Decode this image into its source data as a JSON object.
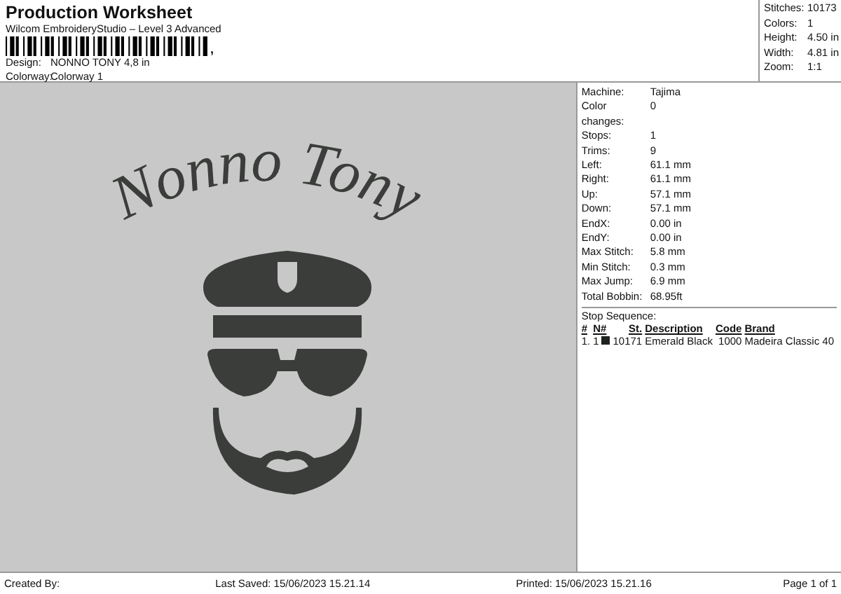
{
  "header": {
    "title": "Production Worksheet",
    "subtitle": "Wilcom EmbroideryStudio – Level 3 Advanced",
    "barcode_mark": ",",
    "fields": [
      {
        "label": "Design:",
        "value": "NONNO TONY 4,8 in"
      },
      {
        "label": "Colorway:",
        "value": "Colorway 1"
      }
    ]
  },
  "summary": [
    {
      "label": "Stitches:",
      "value": "10173"
    },
    {
      "label": "Colors:",
      "value": "1"
    },
    {
      "label": "Height:",
      "value": "4.50 in"
    },
    {
      "label": "Width:",
      "value": "4.81 in"
    },
    {
      "label": "Zoom:",
      "value": "1:1"
    }
  ],
  "design": {
    "lettering": "Nonno Tony"
  },
  "details": [
    {
      "label": "Machine:",
      "value": "Tajima"
    },
    {
      "label": "Color changes:",
      "value": "0"
    },
    {
      "label": "Stops:",
      "value": "1"
    },
    {
      "label": "Trims:",
      "value": "9"
    },
    {
      "label": "Left:",
      "value": "61.1 mm"
    },
    {
      "label": "Right:",
      "value": "61.1 mm"
    },
    {
      "label": "Up:",
      "value": "57.1 mm"
    },
    {
      "label": "Down:",
      "value": "57.1 mm"
    },
    {
      "label": "EndX:",
      "value": "0.00 in"
    },
    {
      "label": "EndY:",
      "value": "0.00 in"
    },
    {
      "label": "Max Stitch:",
      "value": "5.8 mm"
    },
    {
      "label": "Min Stitch:",
      "value": "0.3 mm"
    },
    {
      "label": "Max Jump:",
      "value": "6.9 mm"
    },
    {
      "label": "Total Bobbin:",
      "value": "68.95ft"
    }
  ],
  "stop_sequence": {
    "title": "Stop Sequence:",
    "columns": [
      "#",
      "N#",
      "St.",
      "Description",
      "Code",
      "Brand"
    ],
    "rows": [
      {
        "index": "1.",
        "needle": "1",
        "color": "#1e221e",
        "stitches": "10171",
        "description": "Emerald Black",
        "code": "1000",
        "brand": "Madeira Classic 40"
      }
    ]
  },
  "footer": {
    "created_by": "Created By:",
    "last_saved": "Last Saved: 15/06/2023 15.21.14",
    "printed": "Printed: 15/06/2023 15.21.16",
    "page": "Page 1 of 1"
  }
}
